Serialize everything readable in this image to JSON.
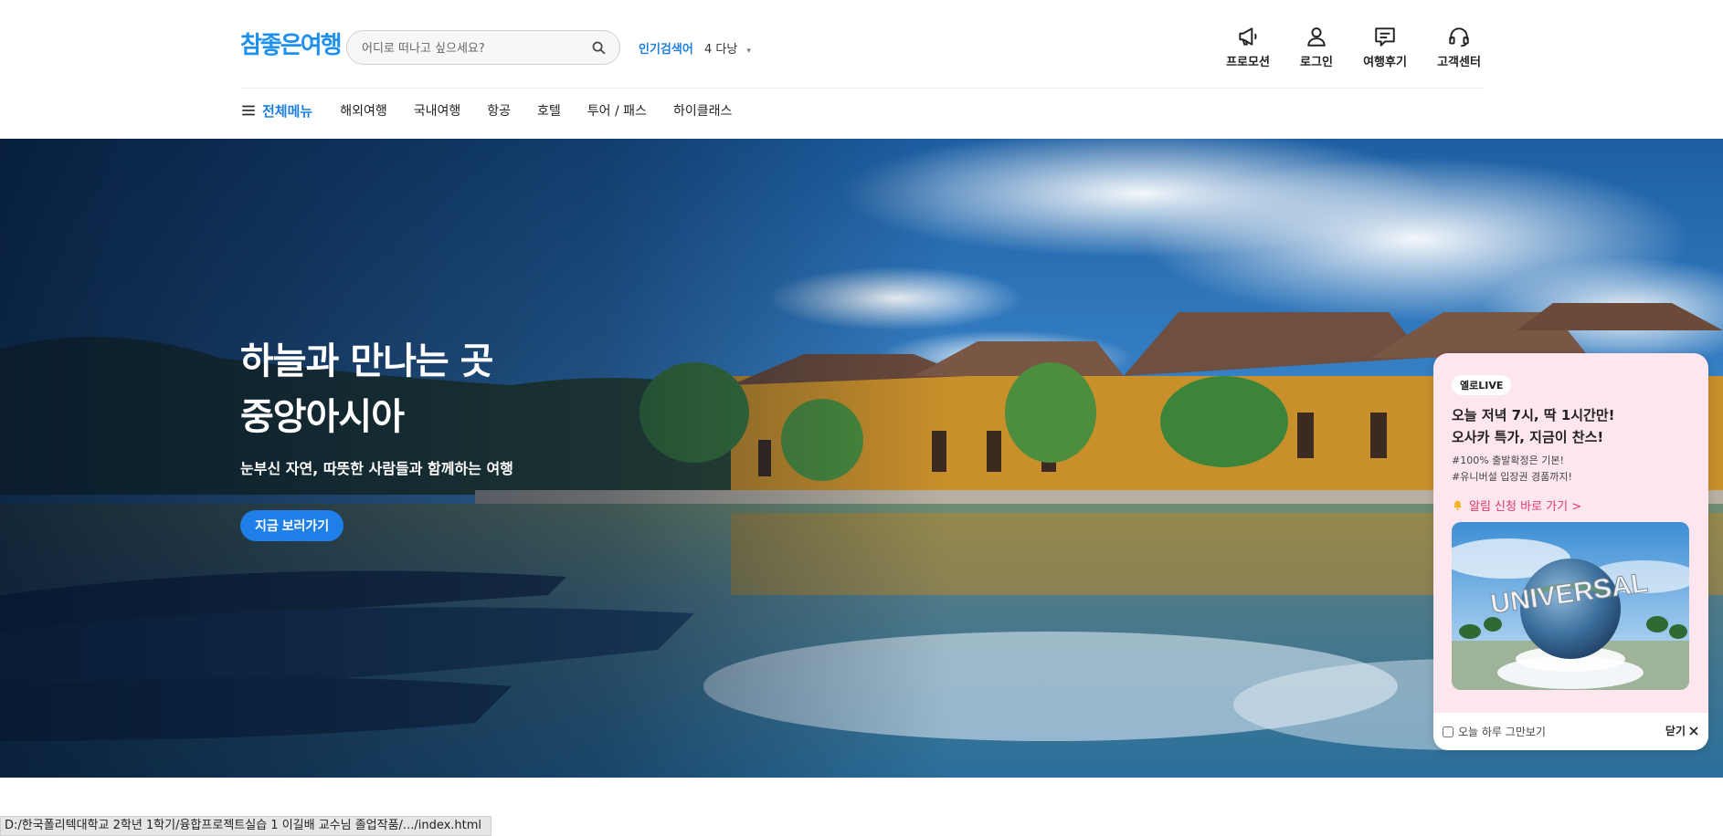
{
  "header": {
    "logo": "참좋은여행",
    "search_placeholder": "어디로 떠나고 싶으세요?",
    "popular_label": "인기검색어",
    "popular_item": "4 다낭",
    "utils": [
      "프로모션",
      "로그인",
      "여행후기",
      "고객센터"
    ]
  },
  "nav": {
    "menu_all": "전체메뉴",
    "items": [
      "해외여행",
      "국내여행",
      "항공",
      "호텔",
      "투어 / 패스",
      "하이클래스"
    ]
  },
  "hero": {
    "title_line1": "하늘과 만나는 곳",
    "title_line2": "중앙아시아",
    "subtitle": "눈부신 자연, 따뜻한 사람들과 함께하는 여행",
    "button": "지금 보러가기"
  },
  "popup": {
    "badge": "옐로LIVE",
    "title_line1": "오늘 저녁 7시, 딱 1시간만!",
    "title_line2": "오사카 특가, 지금이 찬스!",
    "tag1": "#100% 출발확정은 기본!",
    "tag2": "#유니버설 입장권 경품까지!",
    "link": "알림 신청 바로 가기 >",
    "image_text": "UNIVERSAL",
    "dont_show": "오늘 하루 그만보기",
    "close": "닫기"
  },
  "statusbar": {
    "url": "D:/한국폴리텍대학교 2학년 1학기/융합프로젝트실습 1 이길배 교수님 졸업작품/.../index.html"
  },
  "colors": {
    "brand_blue": "#1e7fe8",
    "popup_bg": "#fde6ee",
    "link_pink": "#e23a6a"
  }
}
